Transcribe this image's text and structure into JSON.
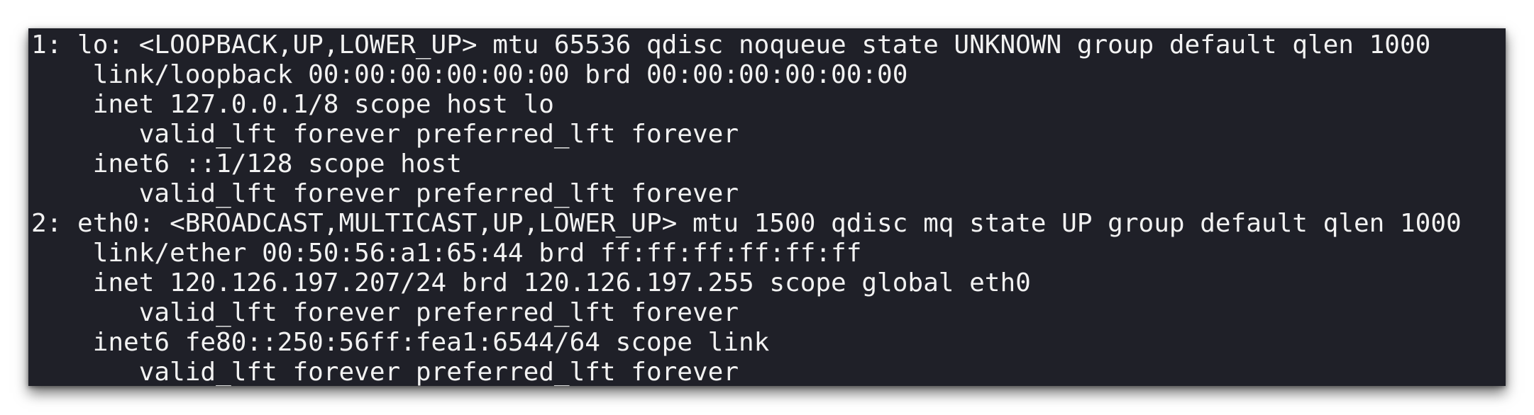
{
  "terminal": {
    "background": "#1f2028",
    "foreground": "#f2f2f2",
    "lines": [
      "1: lo: <LOOPBACK,UP,LOWER_UP> mtu 65536 qdisc noqueue state UNKNOWN group default qlen 1000",
      "    link/loopback 00:00:00:00:00:00 brd 00:00:00:00:00:00",
      "    inet 127.0.0.1/8 scope host lo",
      "       valid_lft forever preferred_lft forever",
      "    inet6 ::1/128 scope host",
      "       valid_lft forever preferred_lft forever",
      "2: eth0: <BROADCAST,MULTICAST,UP,LOWER_UP> mtu 1500 qdisc mq state UP group default qlen 1000",
      "    link/ether 00:50:56:a1:65:44 brd ff:ff:ff:ff:ff:ff",
      "    inet 120.126.197.207/24 brd 120.126.197.255 scope global eth0",
      "       valid_lft forever preferred_lft forever",
      "    inet6 fe80::250:56ff:fea1:6544/64 scope link",
      "       valid_lft forever preferred_lft forever"
    ]
  }
}
